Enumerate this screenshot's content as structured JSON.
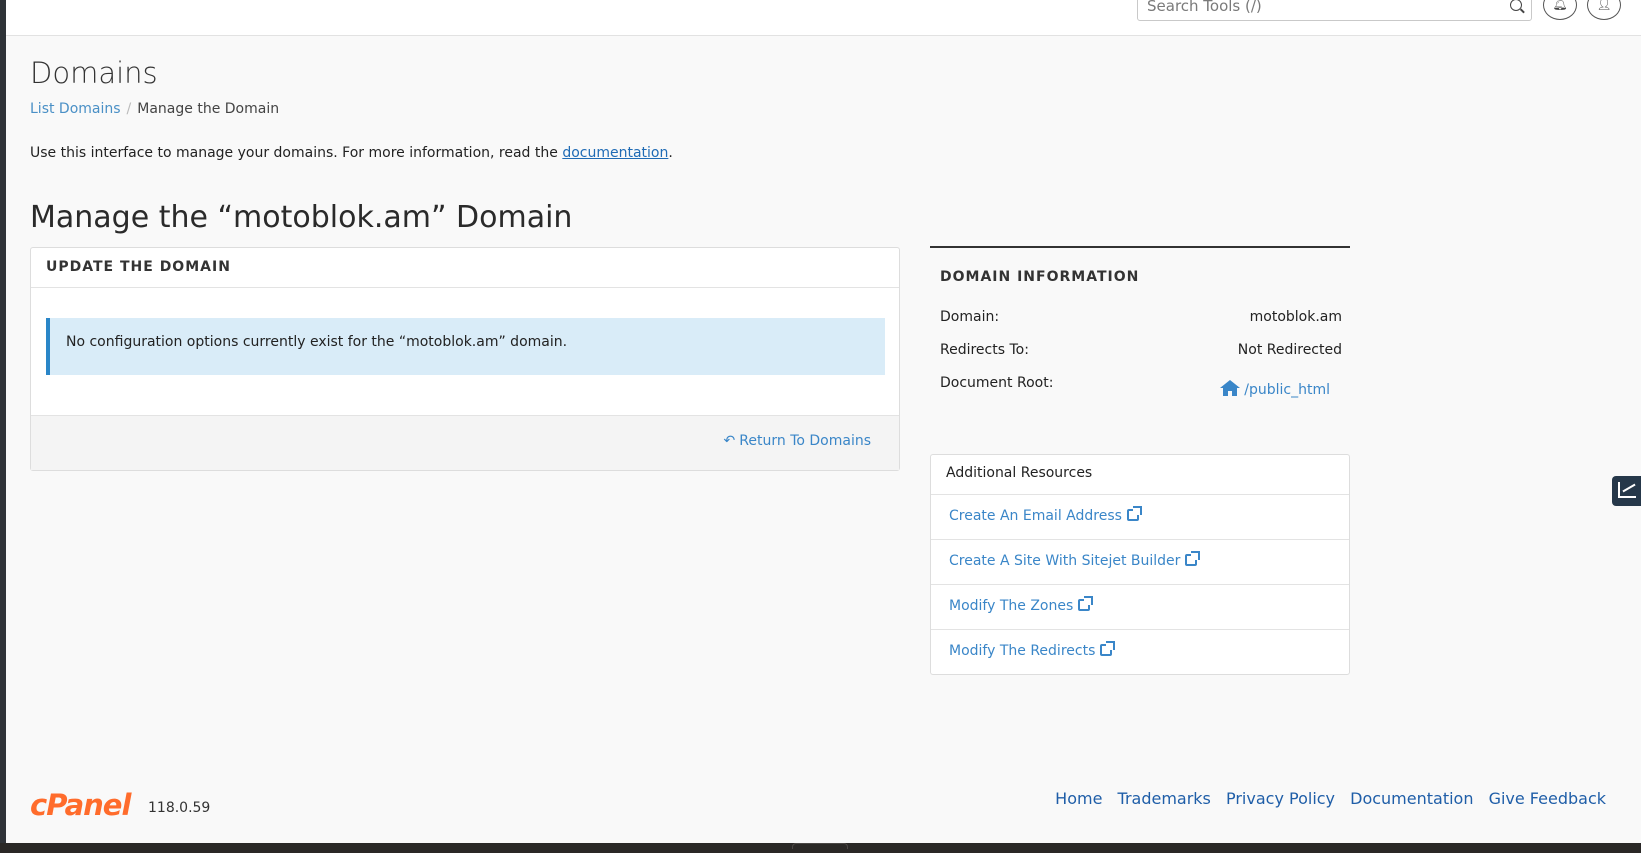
{
  "search": {
    "placeholder": "Search Tools (/)"
  },
  "header": {
    "page_title": "Domains"
  },
  "breadcrumb": {
    "parent": "List Domains",
    "current": "Manage the Domain"
  },
  "intro": {
    "text": "Use this interface to manage your domains. For more information, read the ",
    "link": "documentation",
    "end": "."
  },
  "manage": {
    "title": "Manage the “motoblok.am” Domain"
  },
  "update_card": {
    "heading": "UPDATE THE DOMAIN",
    "alert": "No configuration options currently exist for the “motoblok.am” domain.",
    "return_label": "Return To Domains"
  },
  "domain_info": {
    "heading": "DOMAIN INFORMATION",
    "rows": [
      {
        "label": "Domain:",
        "value": "motoblok.am"
      },
      {
        "label": "Redirects To:",
        "value": "Not Redirected"
      },
      {
        "label": "Document Root:",
        "value": "/public_html"
      }
    ]
  },
  "resources": {
    "heading": "Additional Resources",
    "items": [
      "Create An Email Address",
      "Create A Site With Sitejet Builder",
      "Modify The Zones",
      "Modify The Redirects"
    ]
  },
  "footer": {
    "logo": "cPanel",
    "version": "118.0.59",
    "links": [
      "Home",
      "Trademarks",
      "Privacy Policy",
      "Documentation",
      "Give Feedback"
    ]
  },
  "colors": {
    "accent": "#3a86c8",
    "brand": "#ff6c2c",
    "alert_bg": "#d9ecf8"
  },
  "icons": {
    "search": "search-icon",
    "bell": "bell-icon",
    "user": "user-icon",
    "home": "home-icon",
    "external": "external-link-icon",
    "reply": "reply-arrow-icon",
    "stats": "stats-chart-icon"
  }
}
